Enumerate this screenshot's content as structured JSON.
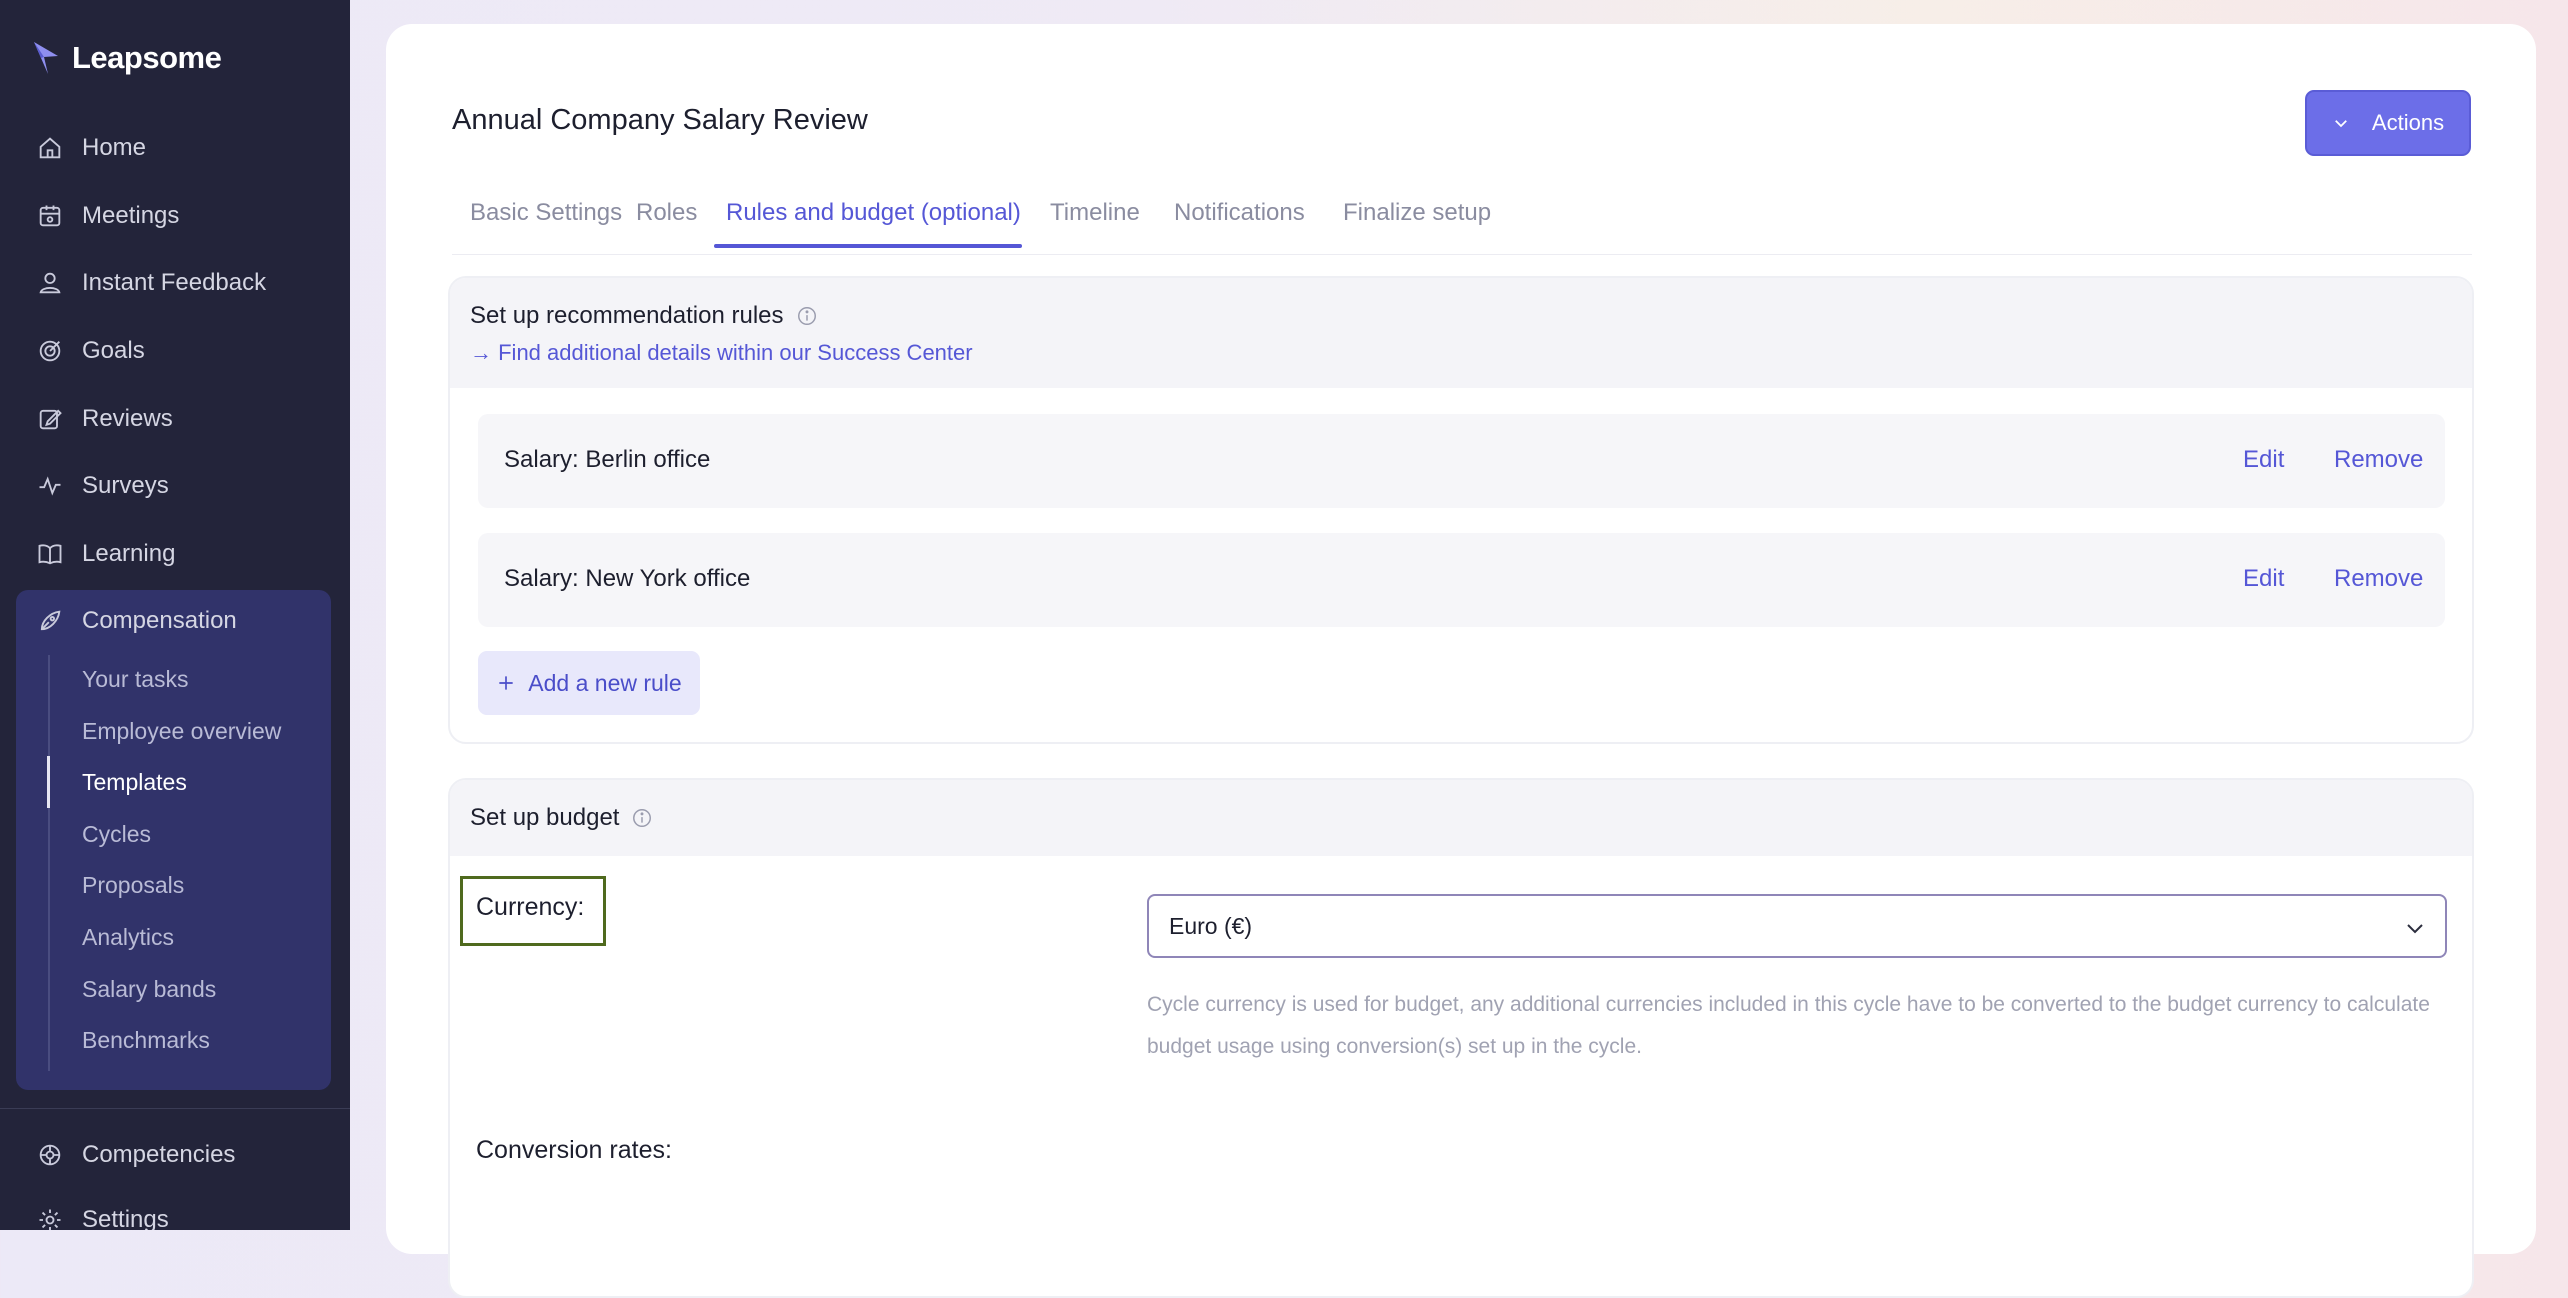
{
  "sidebar": {
    "logo": "Leapsome",
    "nav": [
      {
        "label": "Home",
        "icon": "home-icon"
      },
      {
        "label": "Meetings",
        "icon": "meetings-icon"
      },
      {
        "label": "Instant Feedback",
        "icon": "feedback-icon"
      },
      {
        "label": "Goals",
        "icon": "goals-icon"
      },
      {
        "label": "Reviews",
        "icon": "reviews-icon"
      },
      {
        "label": "Surveys",
        "icon": "surveys-icon"
      },
      {
        "label": "Learning",
        "icon": "learning-icon"
      },
      {
        "label": "Compensation",
        "icon": "compensation-icon"
      }
    ],
    "compensation_sub": [
      "Your tasks",
      "Employee overview",
      "Templates",
      "Cycles",
      "Proposals",
      "Analytics",
      "Salary bands",
      "Benchmarks"
    ],
    "active_sub": "Templates",
    "bottom_nav": [
      {
        "label": "Competencies",
        "icon": "competencies-icon"
      },
      {
        "label": "Settings",
        "icon": "settings-icon"
      }
    ]
  },
  "header": {
    "title": "Annual Company Salary Review",
    "actions_label": "Actions"
  },
  "tabs": [
    "Basic Settings",
    "Roles",
    "Rules and budget (optional)",
    "Timeline",
    "Notifications",
    "Finalize setup"
  ],
  "active_tab": "Rules and budget (optional)",
  "rules": {
    "title": "Set up recommendation rules",
    "help_link": "→ Find additional details within our Success Center",
    "items": [
      {
        "name": "Salary: Berlin office",
        "edit": "Edit",
        "remove": "Remove"
      },
      {
        "name": "Salary: New York office",
        "edit": "Edit",
        "remove": "Remove"
      }
    ],
    "add_label": "Add a new rule"
  },
  "budget": {
    "title": "Set up budget",
    "currency_label": "Currency:",
    "currency_value": "Euro (€)",
    "help_text": "Cycle currency is used for budget, any additional currencies included in this cycle have to be converted to the budget currency to calculate budget usage using conversion(s) set up in the cycle.",
    "conversion_label": "Conversion rates:"
  },
  "colors": {
    "accent": "#5557d6",
    "sidebar": "#23243a",
    "actions_button": "#6c6ee8"
  }
}
